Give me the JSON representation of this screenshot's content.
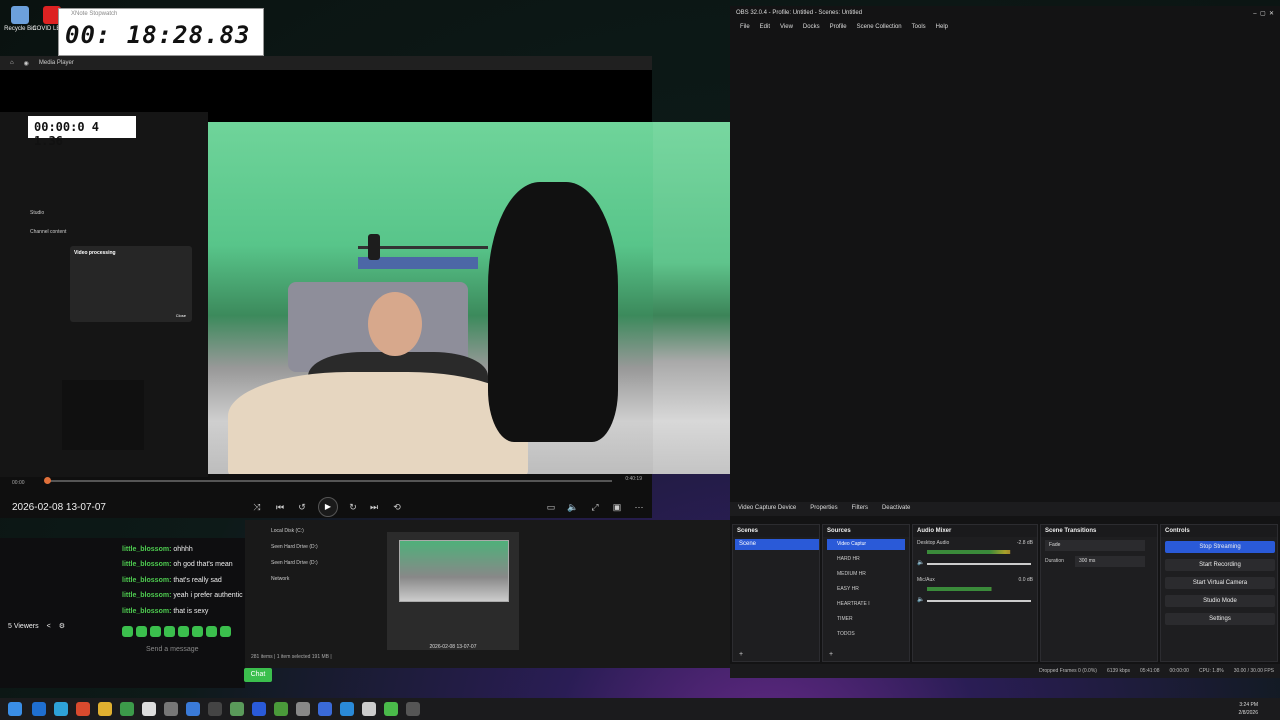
{
  "desktop": {
    "icons": [
      {
        "label": "Recycle Bin"
      },
      {
        "label": "COVID LETTE"
      }
    ]
  },
  "stopwatch": {
    "title": "XNote Stopwatch",
    "time": "00: 18:28.83"
  },
  "media_player": {
    "title": "Media Player",
    "position": "00:00",
    "duration": "0:40:19",
    "file_title": "2026-02-08 13-07-07",
    "progress": 0.005
  },
  "pip": {
    "stopwatch_time": "00:00:0 4 1.36",
    "nav_label": "Studio",
    "section": "Channel content",
    "dialog_title": "Video processing",
    "dialog_button": "Close"
  },
  "chat": {
    "messages": [
      {
        "user": "little_blossom:",
        "text": "ohhhh"
      },
      {
        "user": "little_blossom:",
        "text": "oh god that's mean"
      },
      {
        "user": "little_blossom:",
        "text": "that's really sad"
      },
      {
        "user": "little_blossom:",
        "text": "yeah i prefer authentic p"
      },
      {
        "user": "little_blossom:",
        "text": "that is sexy"
      }
    ],
    "viewers": "5 Viewers",
    "placeholder": "Send a message",
    "chat_button": "Chat"
  },
  "explorer": {
    "tree": [
      "Local Disk (C:)",
      "Seen Hard Drive (D:)",
      "Seen Hard Drive (D:)",
      "Network"
    ],
    "thumbnail_name": "2026-02-08 13-07-07",
    "status": "281 items  |  1 item selected  191 MB  |"
  },
  "obs": {
    "title": "OBS 32.0.4 - Profile: Untitled - Scenes: Untitled",
    "menu": [
      "File",
      "Edit",
      "View",
      "Docks",
      "Profile",
      "Scene Collection",
      "Tools",
      "Help"
    ],
    "toolbar": {
      "source_name": "Video Capture Device",
      "properties": "Properties",
      "filters": "Filters",
      "deactivate": "Deactivate"
    },
    "docks": {
      "scenes": "Scenes",
      "sources": "Sources",
      "audio_mixer": "Audio Mixer",
      "scene_transitions": "Scene Transitions",
      "controls": "Controls"
    },
    "scene_name": "Scene",
    "sources": [
      "Video Captur",
      "HARD HR",
      "MEDIUM HR",
      "EASY HR",
      "HEARTRATE I",
      "TIMER",
      "TODOS"
    ],
    "mixer": [
      {
        "name": "Desktop Audio",
        "db": "-2.8 dB",
        "level": 0.8
      },
      {
        "name": "Mic/Aux",
        "db": "0.0 dB",
        "level": 0.62
      }
    ],
    "transition": {
      "type": "Fade",
      "duration_label": "Duration",
      "duration": "300 ms"
    },
    "controls": [
      "Stop Streaming",
      "Start Recording",
      "Start Virtual Camera",
      "Studio Mode",
      "Settings"
    ],
    "status": {
      "dropped": "Dropped Frames 0 (0.0%)",
      "bitrate": "6139 kbps",
      "live_time": "05:41:08",
      "rec_time": "00:00:00",
      "cpu": "CPU: 1.8%",
      "fps": "30.00 / 30.00 FPS"
    }
  },
  "taskbar": {
    "time": "3:24 PM",
    "date": "2/8/2026"
  },
  "colors": {
    "accent": "#2a5ad8",
    "chat_green": "#3bbf4d",
    "progress": "#e0703a"
  }
}
